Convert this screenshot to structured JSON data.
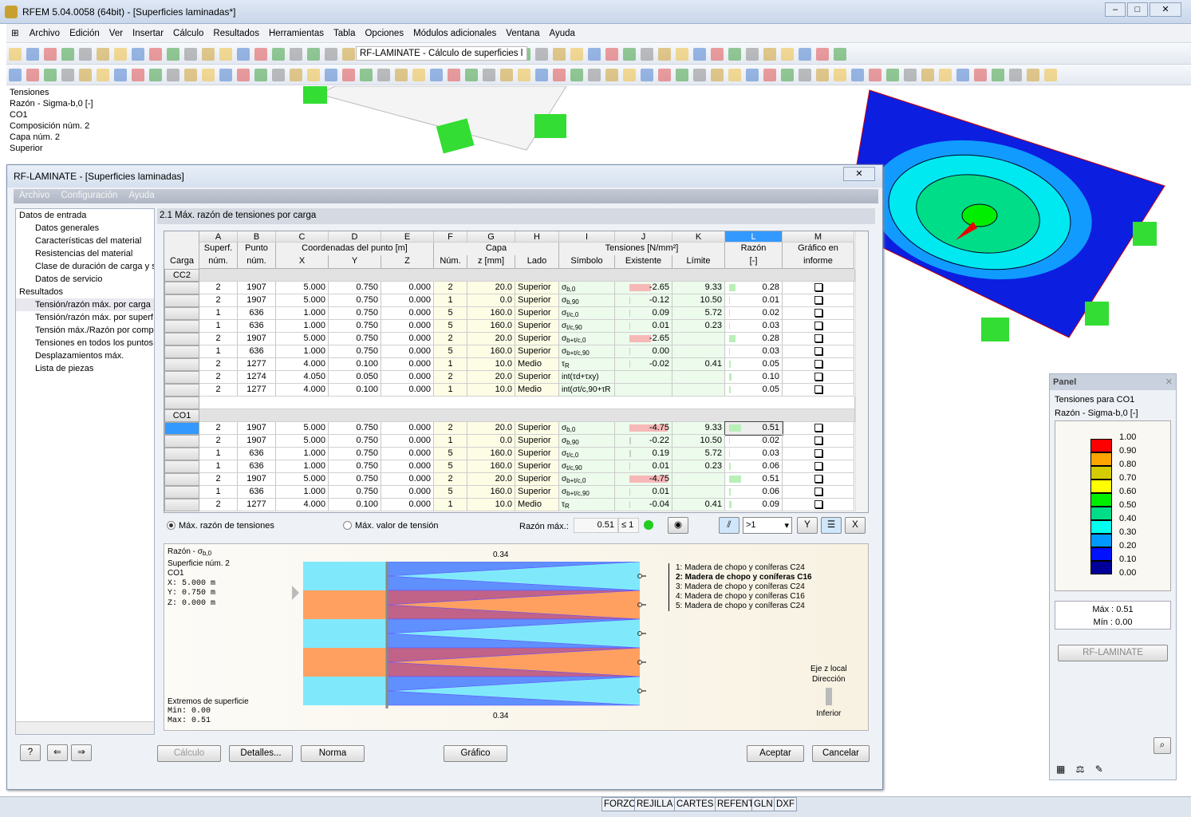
{
  "app": {
    "title": "RFEM 5.04.0058 (64bit) - [Superficies laminadas*]"
  },
  "menu": [
    "Archivo",
    "Edición",
    "Ver",
    "Insertar",
    "Cálculo",
    "Resultados",
    "Herramientas",
    "Tabla",
    "Opciones",
    "Módulos adicionales",
    "Ventana",
    "Ayuda"
  ],
  "toolbar": {
    "module_combo": "RF-LAMINATE - Cálculo de superficies l"
  },
  "view_info": [
    "Tensiones",
    "Razón - Sigma-b,0 [-]",
    "CO1",
    "Composición núm. 2",
    "Capa núm. 2",
    "Superior"
  ],
  "dialog": {
    "title": "RF-LAMINATE - [Superficies laminadas]",
    "menu": [
      "Archivo",
      "Configuración",
      "Ayuda"
    ],
    "tree": [
      {
        "label": "Datos de entrada",
        "level": 1
      },
      {
        "label": "Datos generales",
        "level": 2
      },
      {
        "label": "Características del material",
        "level": 2
      },
      {
        "label": "Resistencias del material",
        "level": 2
      },
      {
        "label": "Clase de duración de carga y se",
        "level": 2
      },
      {
        "label": "Datos de servicio",
        "level": 2
      },
      {
        "label": "Resultados",
        "level": 1
      },
      {
        "label": "Tensión/razón máx. por carga",
        "level": 2,
        "selected": true
      },
      {
        "label": "Tensión/razón máx. por superf",
        "level": 2
      },
      {
        "label": "Tensión máx./Razón por compo",
        "level": 2
      },
      {
        "label": "Tensiones en todos los puntos",
        "level": 2
      },
      {
        "label": "Desplazamientos máx.",
        "level": 2
      },
      {
        "label": "Lista de piezas",
        "level": 2
      }
    ],
    "section_title": "2.1 Máx. razón de tensiones por carga",
    "table": {
      "letters": [
        "A",
        "B",
        "C",
        "D",
        "E",
        "F",
        "G",
        "H",
        "I",
        "J",
        "K",
        "L",
        "M"
      ],
      "group_headers": {
        "carga": "Carga",
        "a": "Superf.",
        "b": "Punto",
        "coords": "Coordenadas del punto [m]",
        "capa": "Capa",
        "tens": "Tensiones [N/mm²]",
        "razon": "Razón",
        "graf": "Gráfico en"
      },
      "sub_headers": [
        "núm.",
        "núm.",
        "X",
        "Y",
        "Z",
        "Núm.",
        "z [mm]",
        "Lado",
        "Símbolo",
        "Existente",
        "Límite",
        "[-]",
        "informe"
      ],
      "groups": [
        {
          "load": "CC2",
          "rows": [
            {
              "sup": "2",
              "pt": "1907",
              "x": "5.000",
              "y": "0.750",
              "z": "0.000",
              "n": "2",
              "zmm": "20.0",
              "lado": "Superior",
              "sym": "σ",
              "sub": "b,0",
              "ex": "-2.65",
              "lim": "9.33",
              "ratio": "0.28"
            },
            {
              "sup": "2",
              "pt": "1907",
              "x": "5.000",
              "y": "0.750",
              "z": "0.000",
              "n": "1",
              "zmm": "0.0",
              "lado": "Superior",
              "sym": "σ",
              "sub": "b,90",
              "ex": "-0.12",
              "lim": "10.50",
              "ratio": "0.01"
            },
            {
              "sup": "1",
              "pt": "636",
              "x": "1.000",
              "y": "0.750",
              "z": "0.000",
              "n": "5",
              "zmm": "160.0",
              "lado": "Superior",
              "sym": "σ",
              "sub": "t/c,0",
              "ex": "0.09",
              "lim": "5.72",
              "ratio": "0.02"
            },
            {
              "sup": "1",
              "pt": "636",
              "x": "1.000",
              "y": "0.750",
              "z": "0.000",
              "n": "5",
              "zmm": "160.0",
              "lado": "Superior",
              "sym": "σ",
              "sub": "t/c,90",
              "ex": "0.01",
              "lim": "0.23",
              "ratio": "0.03"
            },
            {
              "sup": "2",
              "pt": "1907",
              "x": "5.000",
              "y": "0.750",
              "z": "0.000",
              "n": "2",
              "zmm": "20.0",
              "lado": "Superior",
              "sym": "σ",
              "sub": "b+t/c,0",
              "ex": "-2.65",
              "lim": "",
              "ratio": "0.28"
            },
            {
              "sup": "1",
              "pt": "636",
              "x": "1.000",
              "y": "0.750",
              "z": "0.000",
              "n": "5",
              "zmm": "160.0",
              "lado": "Superior",
              "sym": "σ",
              "sub": "b+t/c,90",
              "ex": "0.00",
              "lim": "",
              "ratio": "0.03"
            },
            {
              "sup": "2",
              "pt": "1277",
              "x": "4.000",
              "y": "0.100",
              "z": "0.000",
              "n": "1",
              "zmm": "10.0",
              "lado": "Medio",
              "sym": "τ",
              "sub": "R",
              "ex": "-0.02",
              "lim": "0.41",
              "ratio": "0.05"
            },
            {
              "sup": "2",
              "pt": "1274",
              "x": "4.050",
              "y": "0.050",
              "z": "0.000",
              "n": "2",
              "zmm": "20.0",
              "lado": "Superior",
              "sym": "int(τd+τxy)",
              "sub": "",
              "ex": "",
              "lim": "",
              "ratio": "0.10"
            },
            {
              "sup": "2",
              "pt": "1277",
              "x": "4.000",
              "y": "0.100",
              "z": "0.000",
              "n": "1",
              "zmm": "10.0",
              "lado": "Medio",
              "sym": "int(σt/c,90+τR",
              "sub": "",
              "ex": "",
              "lim": "",
              "ratio": "0.05"
            }
          ]
        },
        {
          "load": "CO1",
          "rows": [
            {
              "sup": "2",
              "pt": "1907",
              "x": "5.000",
              "y": "0.750",
              "z": "0.000",
              "n": "2",
              "zmm": "20.0",
              "lado": "Superior",
              "sym": "σ",
              "sub": "b,0",
              "ex": "-4.75",
              "lim": "9.33",
              "ratio": "0.51",
              "selected": true
            },
            {
              "sup": "2",
              "pt": "1907",
              "x": "5.000",
              "y": "0.750",
              "z": "0.000",
              "n": "1",
              "zmm": "0.0",
              "lado": "Superior",
              "sym": "σ",
              "sub": "b,90",
              "ex": "-0.22",
              "lim": "10.50",
              "ratio": "0.02"
            },
            {
              "sup": "1",
              "pt": "636",
              "x": "1.000",
              "y": "0.750",
              "z": "0.000",
              "n": "5",
              "zmm": "160.0",
              "lado": "Superior",
              "sym": "σ",
              "sub": "t/c,0",
              "ex": "0.19",
              "lim": "5.72",
              "ratio": "0.03"
            },
            {
              "sup": "1",
              "pt": "636",
              "x": "1.000",
              "y": "0.750",
              "z": "0.000",
              "n": "5",
              "zmm": "160.0",
              "lado": "Superior",
              "sym": "σ",
              "sub": "t/c,90",
              "ex": "0.01",
              "lim": "0.23",
              "ratio": "0.06"
            },
            {
              "sup": "2",
              "pt": "1907",
              "x": "5.000",
              "y": "0.750",
              "z": "0.000",
              "n": "2",
              "zmm": "20.0",
              "lado": "Superior",
              "sym": "σ",
              "sub": "b+t/c,0",
              "ex": "-4.75",
              "lim": "",
              "ratio": "0.51"
            },
            {
              "sup": "1",
              "pt": "636",
              "x": "1.000",
              "y": "0.750",
              "z": "0.000",
              "n": "5",
              "zmm": "160.0",
              "lado": "Superior",
              "sym": "σ",
              "sub": "b+t/c,90",
              "ex": "0.01",
              "lim": "",
              "ratio": "0.06"
            },
            {
              "sup": "2",
              "pt": "1277",
              "x": "4.000",
              "y": "0.100",
              "z": "0.000",
              "n": "1",
              "zmm": "10.0",
              "lado": "Medio",
              "sym": "τ",
              "sub": "R",
              "ex": "-0.04",
              "lim": "0.41",
              "ratio": "0.09"
            }
          ]
        }
      ]
    },
    "options": {
      "radio1": "Máx. razón de tensiones",
      "radio2": "Máx. valor de tensión",
      "max_label": "Razón máx.:",
      "max_value": "0.51",
      "max_cond": "≤ 1",
      "filter": ">1"
    },
    "diagram": {
      "title": "Razón - σ",
      "title_sub": "b,0",
      "surface": "Superficie núm. 2",
      "load": "CO1",
      "x": "X: 5.000  m",
      "y": "Y: 0.750  m",
      "z": "Z: 0.000  m",
      "extremes": "Extremos de superficie",
      "min": "Min:  0.00",
      "max": "Max: 0.51",
      "top_value": "0.34",
      "bottom_value": "0.34",
      "layers": [
        "1: Madera de chopo y coníferas C24",
        "2: Madera de chopo y coníferas C16",
        "3: Madera de chopo y coníferas C24",
        "4: Madera de chopo y coníferas C16",
        "5: Madera de chopo y coníferas C24"
      ],
      "axis1": "Eje z local",
      "axis2": "Dirección",
      "axis3": "Inferior"
    },
    "buttons": {
      "calc": "Cálculo",
      "details": "Detalles...",
      "norma": "Norma",
      "grafico": "Gráfico",
      "accept": "Aceptar",
      "cancel": "Cancelar"
    }
  },
  "panel": {
    "title": "Panel",
    "line1": "Tensiones para CO1",
    "line2": "Razón - Sigma-b,0 [-]",
    "scale": [
      {
        "v": "1.00",
        "c": "#ff0000"
      },
      {
        "v": "0.90",
        "c": "#ffa500"
      },
      {
        "v": "0.80",
        "c": "#d4cc00"
      },
      {
        "v": "0.70",
        "c": "#ffff00"
      },
      {
        "v": "0.60",
        "c": "#00ee00"
      },
      {
        "v": "0.50",
        "c": "#00dd88"
      },
      {
        "v": "0.40",
        "c": "#00ffee"
      },
      {
        "v": "0.30",
        "c": "#0099ff"
      },
      {
        "v": "0.20",
        "c": "#0011ff"
      },
      {
        "v": "0.10",
        "c": "#000099"
      },
      {
        "v": "0.00",
        "c": ""
      }
    ],
    "max": "Máx  :   0.51",
    "min": "Mín   :   0.00",
    "button": "RF-LAMINATE"
  },
  "statusbar": [
    "FORZC",
    "REJILLA",
    "CARTES",
    "REFENT",
    "GLN",
    "DXF"
  ]
}
